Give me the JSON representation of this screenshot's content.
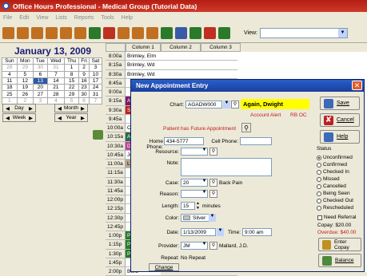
{
  "window": {
    "title": "Office Hours Professional - Medical Group (Tutorial Data)"
  },
  "menu": [
    "File",
    "Edit",
    "View",
    "Lists",
    "Reports",
    "Tools",
    "Help"
  ],
  "toolbar": {
    "view_label": "View:",
    "view_value": "",
    "colors": [
      "#c07020",
      "#c07020",
      "#c07020",
      "#c07020",
      "#c07020",
      "#c07020",
      "#2a7a2a",
      "#c03020",
      "#c07020",
      "#c07020",
      "#c07020",
      "#2a7a2a",
      "#3a5aa8",
      "#2a7a2a",
      "#c03020",
      "#2a7a2a"
    ]
  },
  "calendar": {
    "month_title": "January 13, 2009",
    "weekdays": [
      "Sun",
      "Mon",
      "Tue",
      "Wed",
      "Thu",
      "Fri",
      "Sat"
    ],
    "weeks": [
      [
        "28",
        "29",
        "30",
        "31",
        "1",
        "2",
        "3"
      ],
      [
        "4",
        "5",
        "6",
        "7",
        "8",
        "9",
        "10"
      ],
      [
        "11",
        "12",
        "13",
        "14",
        "15",
        "16",
        "17"
      ],
      [
        "18",
        "19",
        "20",
        "21",
        "22",
        "23",
        "24"
      ],
      [
        "25",
        "26",
        "27",
        "28",
        "29",
        "30",
        "31"
      ],
      [
        "1",
        "2",
        "3",
        "4",
        "5",
        "6",
        "7"
      ]
    ],
    "nav": {
      "day": "Day",
      "month": "Month",
      "week": "Week",
      "year": "Year"
    }
  },
  "schedule": {
    "columns": [
      "Column 1",
      "Column 2",
      "Column 3"
    ],
    "rows": [
      {
        "time": "8:00a",
        "appt": "Brimley, Elm",
        "color": "#ffffff"
      },
      {
        "time": "8:15a",
        "appt": "Brimley, Wd",
        "color": "#ffffff"
      },
      {
        "time": "8:30a",
        "appt": "Brimley, Wd",
        "color": "#ffffff"
      },
      {
        "time": "8:45a",
        "appt": "",
        "color": "#ffffff"
      },
      {
        "time": "9:00a",
        "appt": "",
        "color": "#ffffff"
      },
      {
        "time": "9:15a",
        "appt": "Aga",
        "color": "#7a1a6a"
      },
      {
        "time": "9:30a",
        "appt": "Shu",
        "color": "#c02020"
      },
      {
        "time": "9:45a",
        "appt": "",
        "color": "#ffffff"
      },
      {
        "time": "10:00a",
        "appt": "Cate",
        "color": "#ffffff"
      },
      {
        "time": "10:15a",
        "appt": "Aust",
        "color": "#2a6a4a"
      },
      {
        "time": "10:30a",
        "appt": "Doc",
        "color": "#c040a0"
      },
      {
        "time": "10:45a",
        "appt": "Jona",
        "color": "#ffffff"
      },
      {
        "time": "11:00a",
        "appt": "Lun",
        "color": "#b8a890"
      },
      {
        "time": "11:15a",
        "appt": "",
        "color": "#ffffff"
      },
      {
        "time": "11:30a",
        "appt": "",
        "color": "#ffffff"
      },
      {
        "time": "11:45a",
        "appt": "",
        "color": "#ffffff"
      },
      {
        "time": "12:00p",
        "appt": "",
        "color": "#ffffff"
      },
      {
        "time": "12:15p",
        "appt": "",
        "color": "#ffffff"
      },
      {
        "time": "12:30p",
        "appt": "",
        "color": "#ffffff"
      },
      {
        "time": "12:45p",
        "appt": "",
        "color": "#ffffff"
      },
      {
        "time": "1:00p",
        "appt": "Pete",
        "color": "#2a7a2a"
      },
      {
        "time": "1:15p",
        "appt": "Pete",
        "color": "#2a7a2a"
      },
      {
        "time": "1:30p",
        "appt": "Pete",
        "color": "#2a7a2a"
      },
      {
        "time": "1:45p",
        "appt": "",
        "color": "#ffffff"
      },
      {
        "time": "2:00p",
        "appt": "Bord",
        "color": "#ffffff"
      }
    ]
  },
  "dialog": {
    "title": "New Appointment Entry",
    "chart_label": "Chart:",
    "chart_value": "AGADW000",
    "patient_name": "Again, Dwight",
    "account_alert_label": "Account Alert",
    "account_alert_value": "RB OC",
    "future_appt": "Patient has Future Appointment",
    "home_phone_label": "Home Phone:",
    "home_phone": "434-5777",
    "cell_phone_label": "Cell Phone:",
    "cell_phone": "",
    "resource_label": "Resource:",
    "resource": "",
    "note_label": "Note:",
    "note": "",
    "case_label": "Case:",
    "case_value": "20",
    "case_desc": "Back Pain",
    "reason_label": "Reason:",
    "reason": "",
    "length_label": "Length:",
    "length": "15",
    "length_unit": "minutes",
    "color_label": "Color:",
    "color_value": "Silver",
    "date_label": "Date:",
    "date": "1/13/2009",
    "time_label": "Time:",
    "time": "9:00 am",
    "provider_label": "Provider:",
    "provider": "JM",
    "provider_name": "Mallard, J.D.",
    "repeat_label": "Repeat:",
    "repeat_value": "No Repeat",
    "change_button": "Change",
    "save_button": "Save",
    "cancel_button": "Cancel",
    "help_button": "Help",
    "status_label": "Status",
    "statuses": [
      "Unconfirmed",
      "Confirmed",
      "Checked In",
      "Missed",
      "Cancelled",
      "Being Seen",
      "Checked Out",
      "Rescheduled"
    ],
    "selected_status": "Unconfirmed",
    "need_referral": "Need Referral",
    "copay": "Copay: $20.00",
    "overdue": "Overdue: $40.00",
    "enter_copay_button": "Enter Copay",
    "balance_button": "Balance"
  }
}
